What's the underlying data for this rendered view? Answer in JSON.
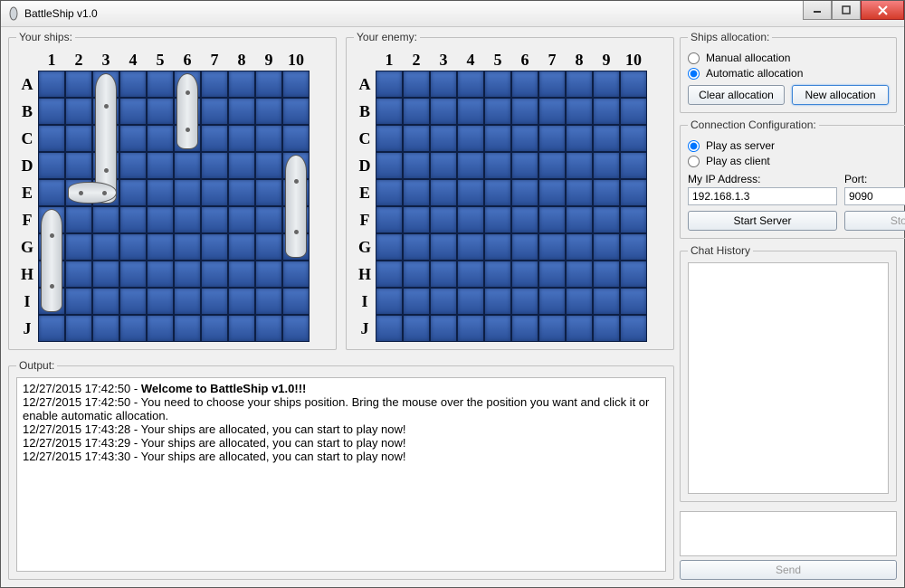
{
  "window": {
    "title": "BattleShip v1.0"
  },
  "boards": {
    "yours_label": "Your ships:",
    "enemy_label": "Your enemy:",
    "columns": [
      "1",
      "2",
      "3",
      "4",
      "5",
      "6",
      "7",
      "8",
      "9",
      "10"
    ],
    "rows": [
      "A",
      "B",
      "C",
      "D",
      "E",
      "F",
      "G",
      "H",
      "I",
      "J"
    ],
    "ships": [
      {
        "row": 0,
        "col": 2,
        "len": 5,
        "orient": "v"
      },
      {
        "row": 0,
        "col": 5,
        "len": 3,
        "orient": "v"
      },
      {
        "row": 3,
        "col": 9,
        "len": 4,
        "orient": "v"
      },
      {
        "row": 4,
        "col": 1,
        "len": 2,
        "orient": "h"
      },
      {
        "row": 5,
        "col": 0,
        "len": 4,
        "orient": "v"
      }
    ]
  },
  "allocation": {
    "legend": "Ships allocation:",
    "manual_label": "Manual allocation",
    "auto_label": "Automatic allocation",
    "selected": "auto",
    "clear_btn": "Clear allocation",
    "new_btn": "New allocation"
  },
  "connection": {
    "legend": "Connection Configuration:",
    "server_label": "Play as server",
    "client_label": "Play as client",
    "selected": "server",
    "ip_label": "My IP Address:",
    "ip_value": "192.168.1.3",
    "port_label": "Port:",
    "port_value": "9090",
    "start_btn": "Start Server",
    "stop_btn": "Stop Server"
  },
  "chat": {
    "legend": "Chat History",
    "send_btn": "Send"
  },
  "output": {
    "legend": "Output:",
    "lines": [
      {
        "ts": "12/27/2015 17:42:50",
        "text": "Welcome to BattleShip v1.0!!!",
        "bold": true
      },
      {
        "ts": "12/27/2015 17:42:50",
        "text": "You need to choose your ships position. Bring the mouse over the position you want and click it or enable automatic allocation.",
        "bold": false
      },
      {
        "ts": "12/27/2015 17:43:28",
        "text": "Your ships are allocated, you can start to play now!",
        "bold": false
      },
      {
        "ts": "12/27/2015 17:43:29",
        "text": "Your ships are allocated, you can start to play now!",
        "bold": false
      },
      {
        "ts": "12/27/2015 17:43:30",
        "text": "Your ships are allocated, you can start to play now!",
        "bold": false
      }
    ]
  }
}
